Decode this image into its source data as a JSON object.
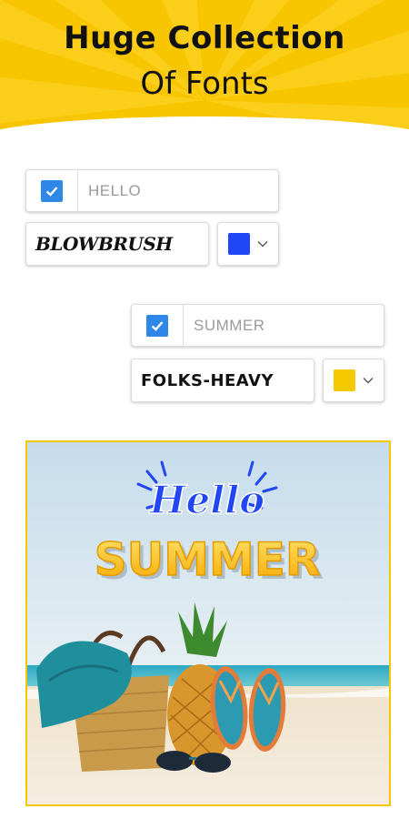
{
  "header": {
    "title_line1": "Huge Collection",
    "title_line2": "Of Fonts"
  },
  "layer1": {
    "checked": true,
    "text_value": "HELLO",
    "font_name": "BLOWBRUSH",
    "color": "#2146f5"
  },
  "layer2": {
    "checked": true,
    "text_value": "SUMMER",
    "font_name": "FOLKS-HEAVY",
    "color": "#f5c800"
  },
  "preview": {
    "text_hello": "Hello",
    "text_summer": "SUMMER"
  },
  "colors": {
    "banner": "#f7c600",
    "checkbox": "#2f88e8",
    "frame": "#f3c800"
  }
}
